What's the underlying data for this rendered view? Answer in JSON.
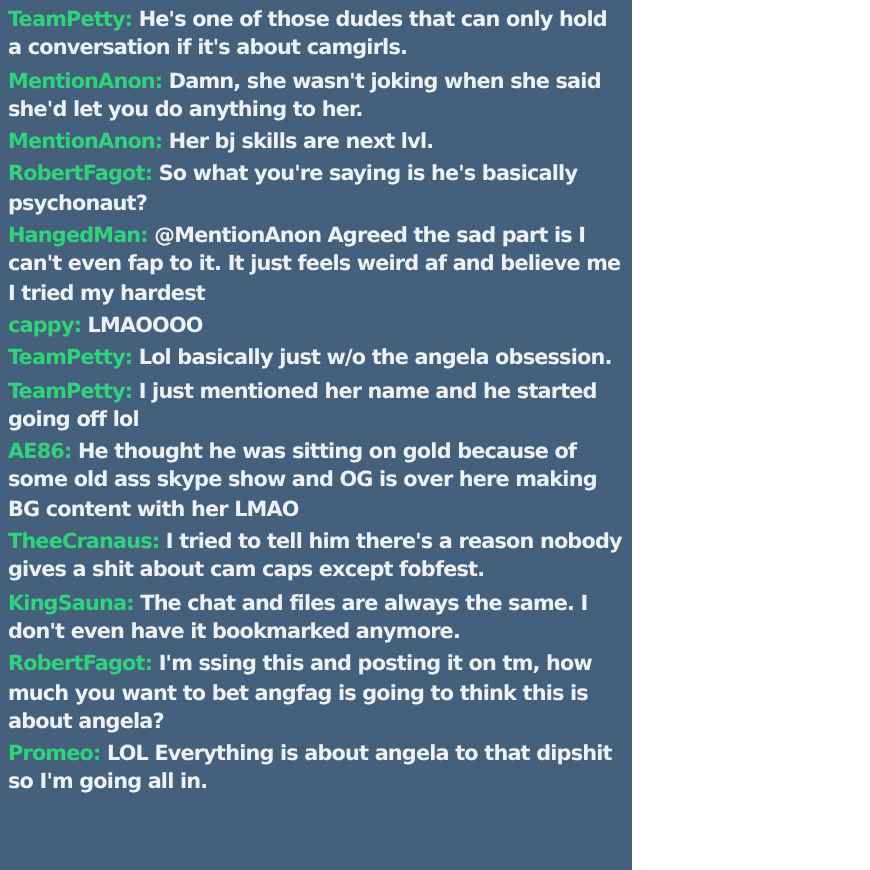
{
  "chat": {
    "messages": [
      {
        "user": "TeamPetty:",
        "text": "He's one of those dudes that can only hold a conversation if it's about camgirls."
      },
      {
        "user": "MentionAnon:",
        "text": "Damn, she wasn't joking when she said she'd let you do anything to her."
      },
      {
        "user": "MentionAnon:",
        "text": "Her bj skills are next lvl."
      },
      {
        "user": "RobertFagot:",
        "text": "So what you're saying is he's basically psychonaut?"
      },
      {
        "user": "HangedMan:",
        "text": "@MentionAnon Agreed the sad part is I can't even fap to it. It just feels weird af and believe me I tried my hardest"
      },
      {
        "user": "cappy:",
        "text": "LMAOOOO"
      },
      {
        "user": "TeamPetty:",
        "text": "Lol basically just w/o the angela obsession."
      },
      {
        "user": "TeamPetty:",
        "text": "I just mentioned her name and he started going off lol"
      },
      {
        "user": "AE86:",
        "text": "He thought he was sitting on gold because of some old ass skype show and OG is over here making BG content with her LMAO"
      },
      {
        "user": "TheeCranaus:",
        "text": "I tried to tell him there's a reason nobody gives a shit about cam caps except fobfest."
      },
      {
        "user": "KingSauna:",
        "text": "The chat and files are always the same. I don't even have it bookmarked anymore."
      },
      {
        "user": "RobertFagot:",
        "text": "I'm ssing this and posting it on tm, how much you want to bet angfag is going to think this is about angela?"
      },
      {
        "user": "Promeo:",
        "text": "LOL Everything is about angela to that dipshit so I'm going all in."
      }
    ]
  }
}
